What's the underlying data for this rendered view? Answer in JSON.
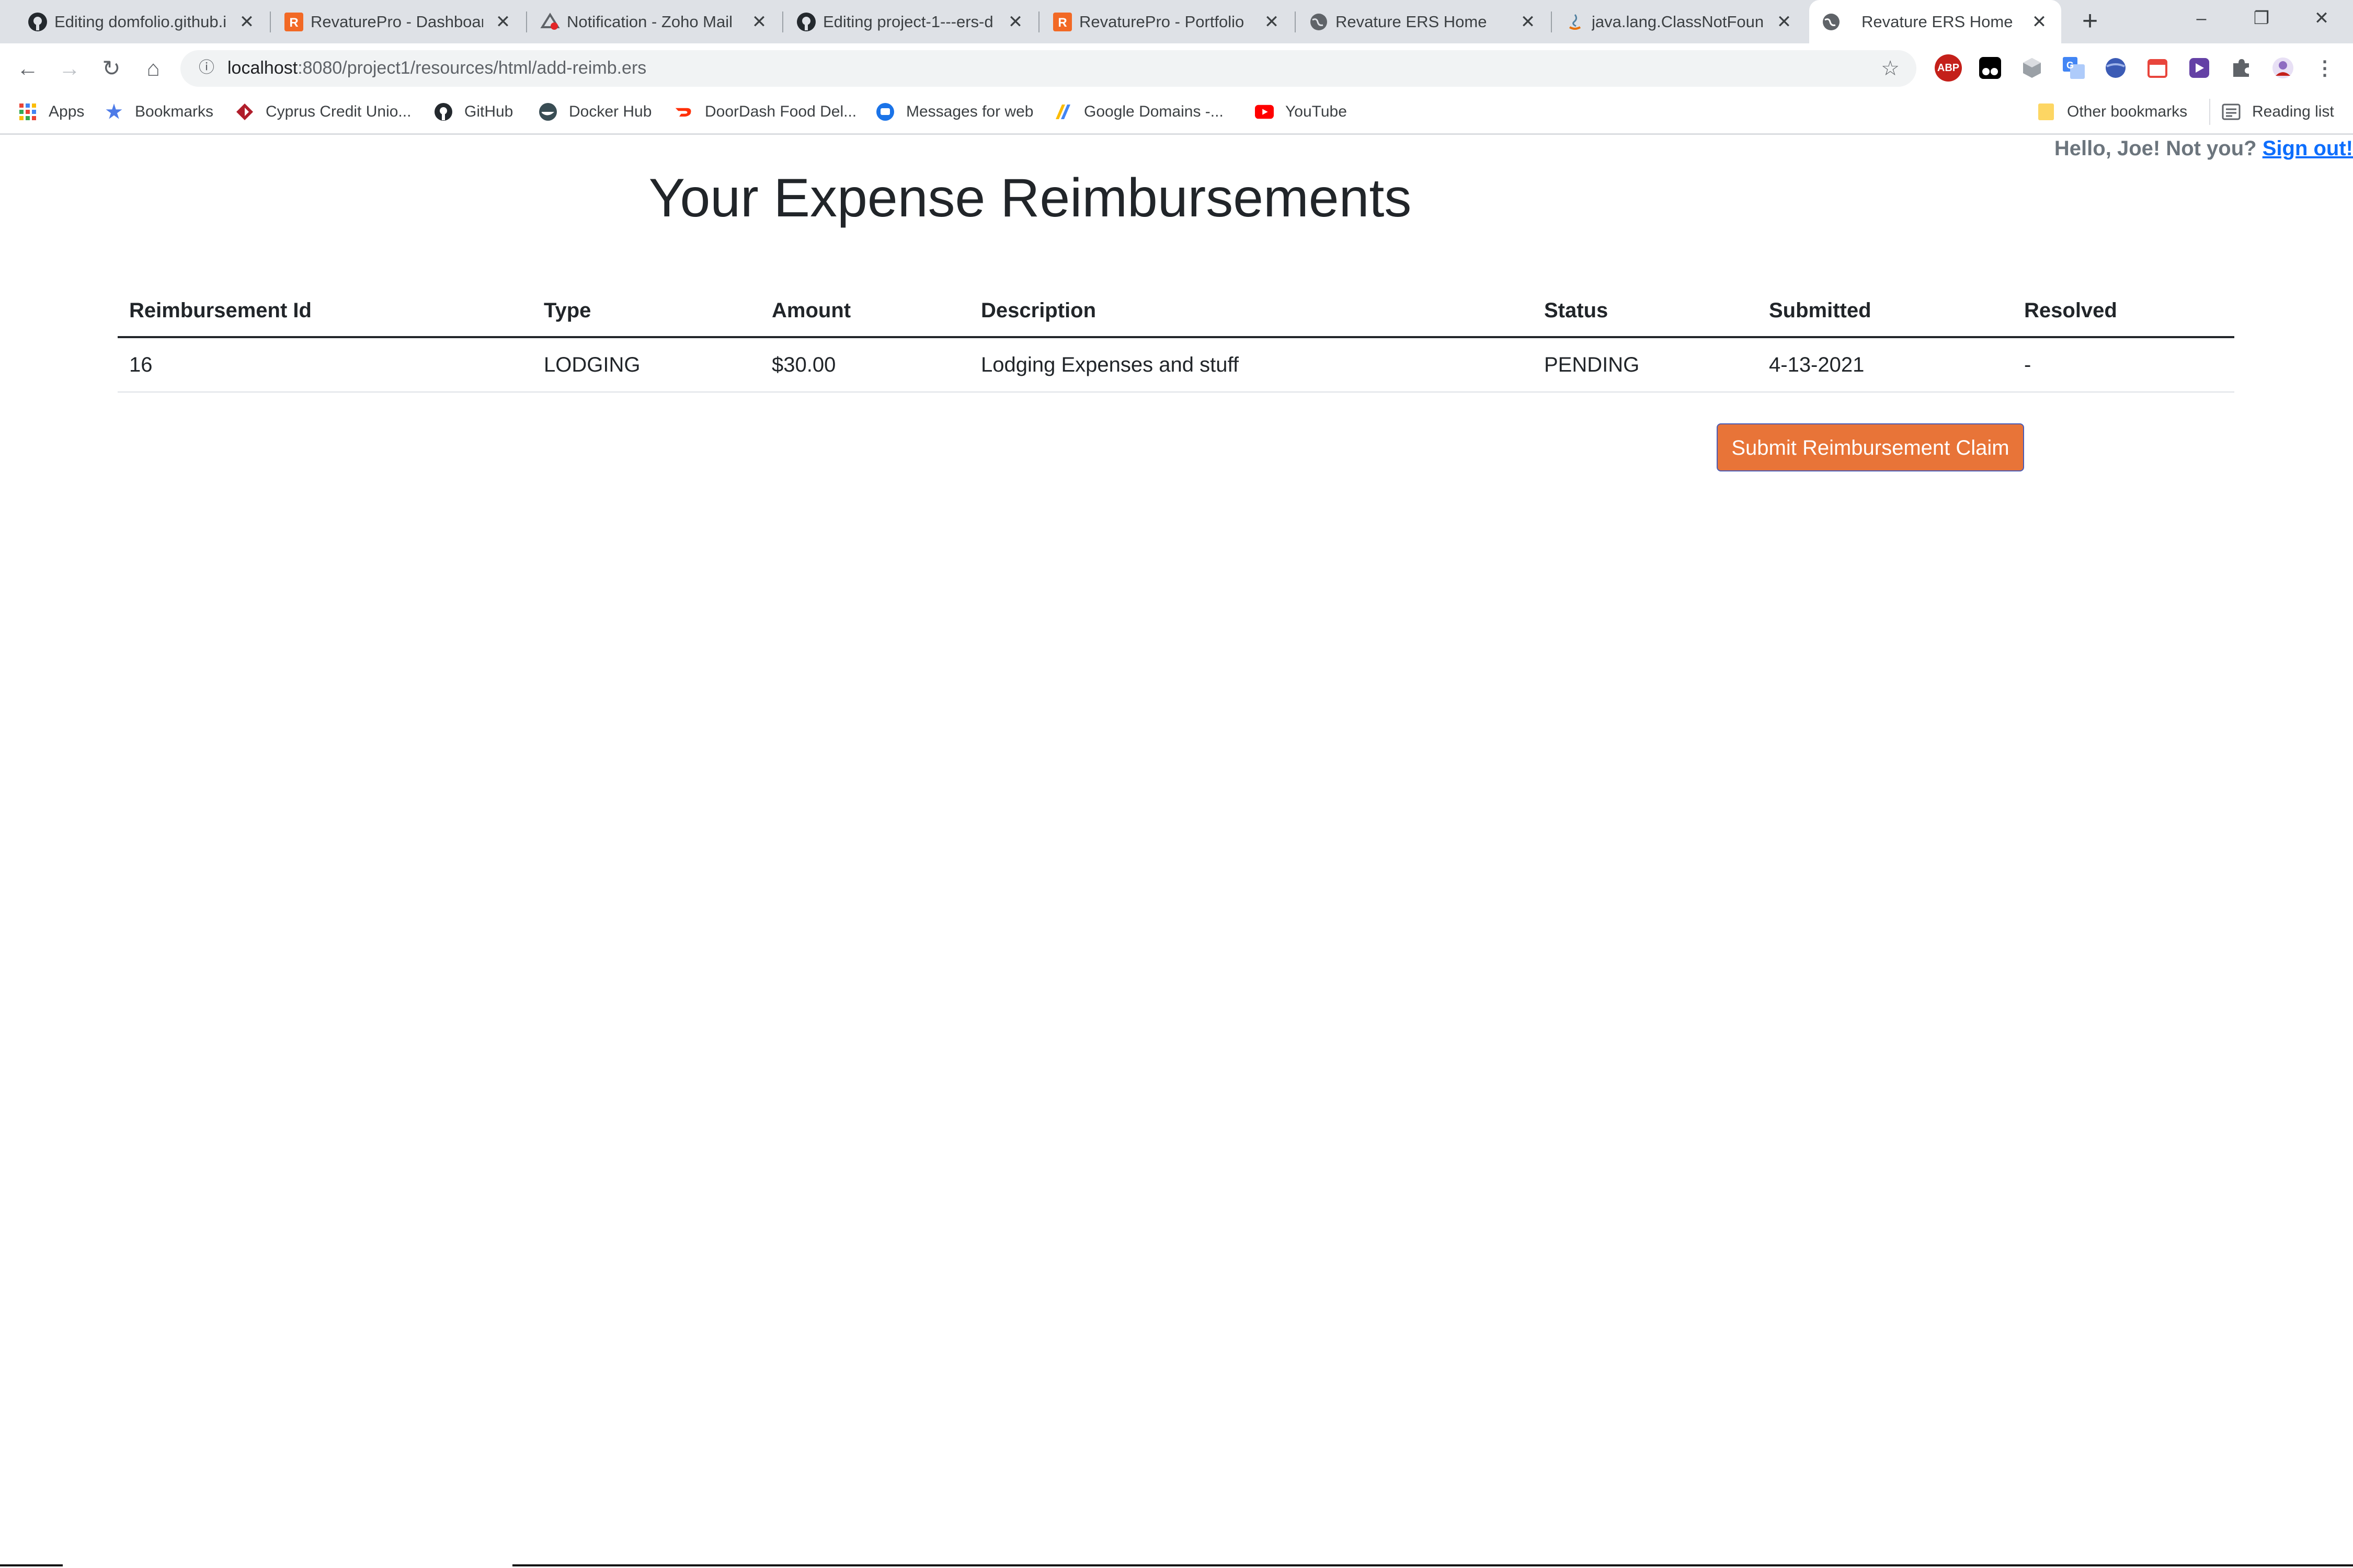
{
  "browser": {
    "tabs": [
      {
        "title": "Editing domfolio.github.io",
        "icon": "github-icon"
      },
      {
        "title": "RevaturePro - Dashboard",
        "icon": "revature-icon"
      },
      {
        "title": "Notification - Zoho Mail",
        "icon": "zoho-icon"
      },
      {
        "title": "Editing project-1---ers-d",
        "icon": "github-icon"
      },
      {
        "title": "RevaturePro - Portfolio",
        "icon": "revature-icon"
      },
      {
        "title": "Revature ERS Home",
        "icon": "globe-icon"
      },
      {
        "title": "java.lang.ClassNotFound",
        "icon": "java-icon"
      },
      {
        "title": "Revature ERS Home",
        "icon": "globe-icon",
        "active": true
      }
    ],
    "close_glyph": "✕",
    "url_host": "localhost",
    "url_rest": ":8080/project1/resources/html/add-reimb.ers",
    "bookmarks": [
      {
        "label": "Apps",
        "icon": "apps-grid-icon"
      },
      {
        "label": "Bookmarks",
        "icon": "star-icon"
      },
      {
        "label": "Cyprus Credit Unio...",
        "icon": "cyprus-icon"
      },
      {
        "label": "GitHub",
        "icon": "github-icon"
      },
      {
        "label": "Docker Hub",
        "icon": "docker-icon"
      },
      {
        "label": "DoorDash Food Del...",
        "icon": "doordash-icon"
      },
      {
        "label": "Messages for web",
        "icon": "messages-icon"
      },
      {
        "label": "Google Domains -...",
        "icon": "google-domains-icon"
      },
      {
        "label": "YouTube",
        "icon": "youtube-icon"
      }
    ],
    "other_bookmarks": "Other bookmarks",
    "reading_list": "Reading list",
    "extensions": [
      {
        "icon": "adblock-plus-icon",
        "text": "ABP",
        "color": "#c4201a"
      },
      {
        "icon": "tampermonkey-icon",
        "text": "",
        "color": "#000000"
      },
      {
        "icon": "cube-extension-icon",
        "text": "",
        "color": "#7b7f85"
      },
      {
        "icon": "translate-icon",
        "text": "",
        "color": "#4285f4"
      },
      {
        "icon": "vpn-globe-icon",
        "text": "",
        "color": "#3b5bb5"
      },
      {
        "icon": "calendar-extension-icon",
        "text": "",
        "color": "#e8453c"
      },
      {
        "icon": "twitch-icon",
        "text": "",
        "color": "#6441a5"
      },
      {
        "icon": "puzzle-icon",
        "text": "",
        "color": "#5f6368"
      },
      {
        "icon": "profile-avatar-icon",
        "text": "",
        "color": "#8e6cc2"
      },
      {
        "icon": "kebab-menu-icon",
        "text": "",
        "color": "#5f6368"
      }
    ]
  },
  "header": {
    "greeting": "Hello, Joe! Not you? ",
    "signout": "Sign out!"
  },
  "main": {
    "title": "Your Expense Reimbursements",
    "columns": [
      "Reimbursement Id",
      "Type",
      "Amount",
      "Description",
      "Status",
      "Submitted",
      "Resolved"
    ],
    "rows": [
      [
        "16",
        "LODGING",
        "$30.00",
        "Lodging Expenses and stuff",
        "PENDING",
        "4-13-2021",
        "-"
      ]
    ],
    "submit_label": "Submit Reimbursement Claim"
  }
}
